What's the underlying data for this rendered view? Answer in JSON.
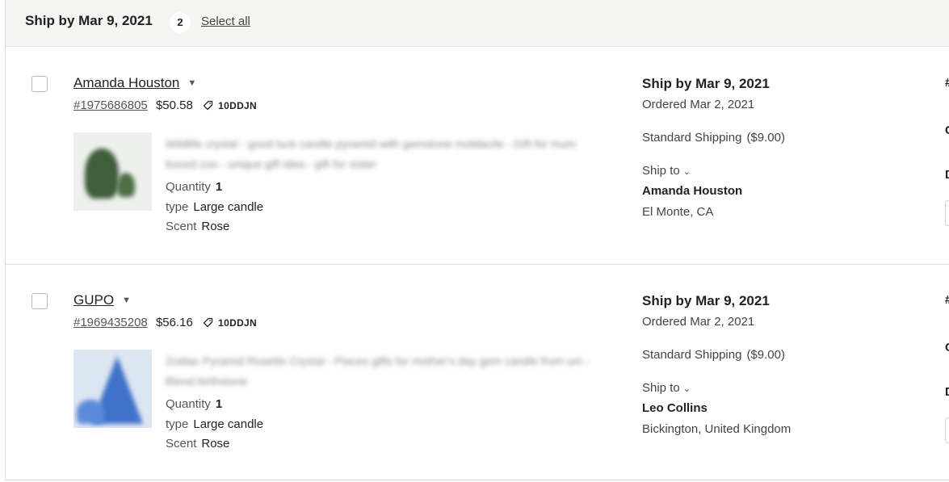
{
  "group": {
    "title": "Ship by Mar 9, 2021",
    "count": "2",
    "select_all": "Select all"
  },
  "orders": [
    {
      "buyer": "Amanda Houston",
      "caret": "▼",
      "order_number": "#1975686805",
      "price": "$50.58",
      "coupon": "10DDJN",
      "title_blurred": "Wildlife crystal - good luck candle pyramid with gemstone moldacite - Gift for mum boxed zoo - unique gift idea - gift for sister",
      "attributes": [
        {
          "label": "Quantity",
          "value": "1"
        },
        {
          "label": "type",
          "value": "Large candle"
        },
        {
          "label": "Scent",
          "value": "Rose"
        }
      ],
      "ship_by": "Ship by Mar 9, 2021",
      "ordered": "Ordered Mar 2, 2021",
      "shipping_method": "Standard Shipping",
      "shipping_cost": "($9.00)",
      "ship_to_label": "Ship to",
      "recipient": "Amanda Houston",
      "location": "El Monte, CA"
    },
    {
      "buyer": "GUPO",
      "caret": "▼",
      "order_number": "#1969435208",
      "price": "$56.16",
      "coupon": "10DDJN",
      "title_blurred": "Zodiac Pyramid Rosette Crystal - Pieces gifts for mother's day gem candle from uni - Blend birthstone",
      "attributes": [
        {
          "label": "Quantity",
          "value": "1"
        },
        {
          "label": "type",
          "value": "Large candle"
        },
        {
          "label": "Scent",
          "value": "Rose"
        }
      ],
      "ship_by": "Ship by Mar 9, 2021",
      "ordered": "Ordered Mar 2, 2021",
      "shipping_method": "Standard Shipping",
      "shipping_cost": "($9.00)",
      "ship_to_label": "Ship to",
      "recipient": "Leo Collins",
      "location": "Bickington, United Kingdom"
    }
  ],
  "icons": {
    "caret": "chevron-down-icon",
    "coupon": "tag-icon",
    "ship_to": "chevron-down-icon"
  },
  "colors": {
    "header_bg": "#f5f5f3",
    "divider": "#e1e1e1",
    "text": "#222222"
  }
}
